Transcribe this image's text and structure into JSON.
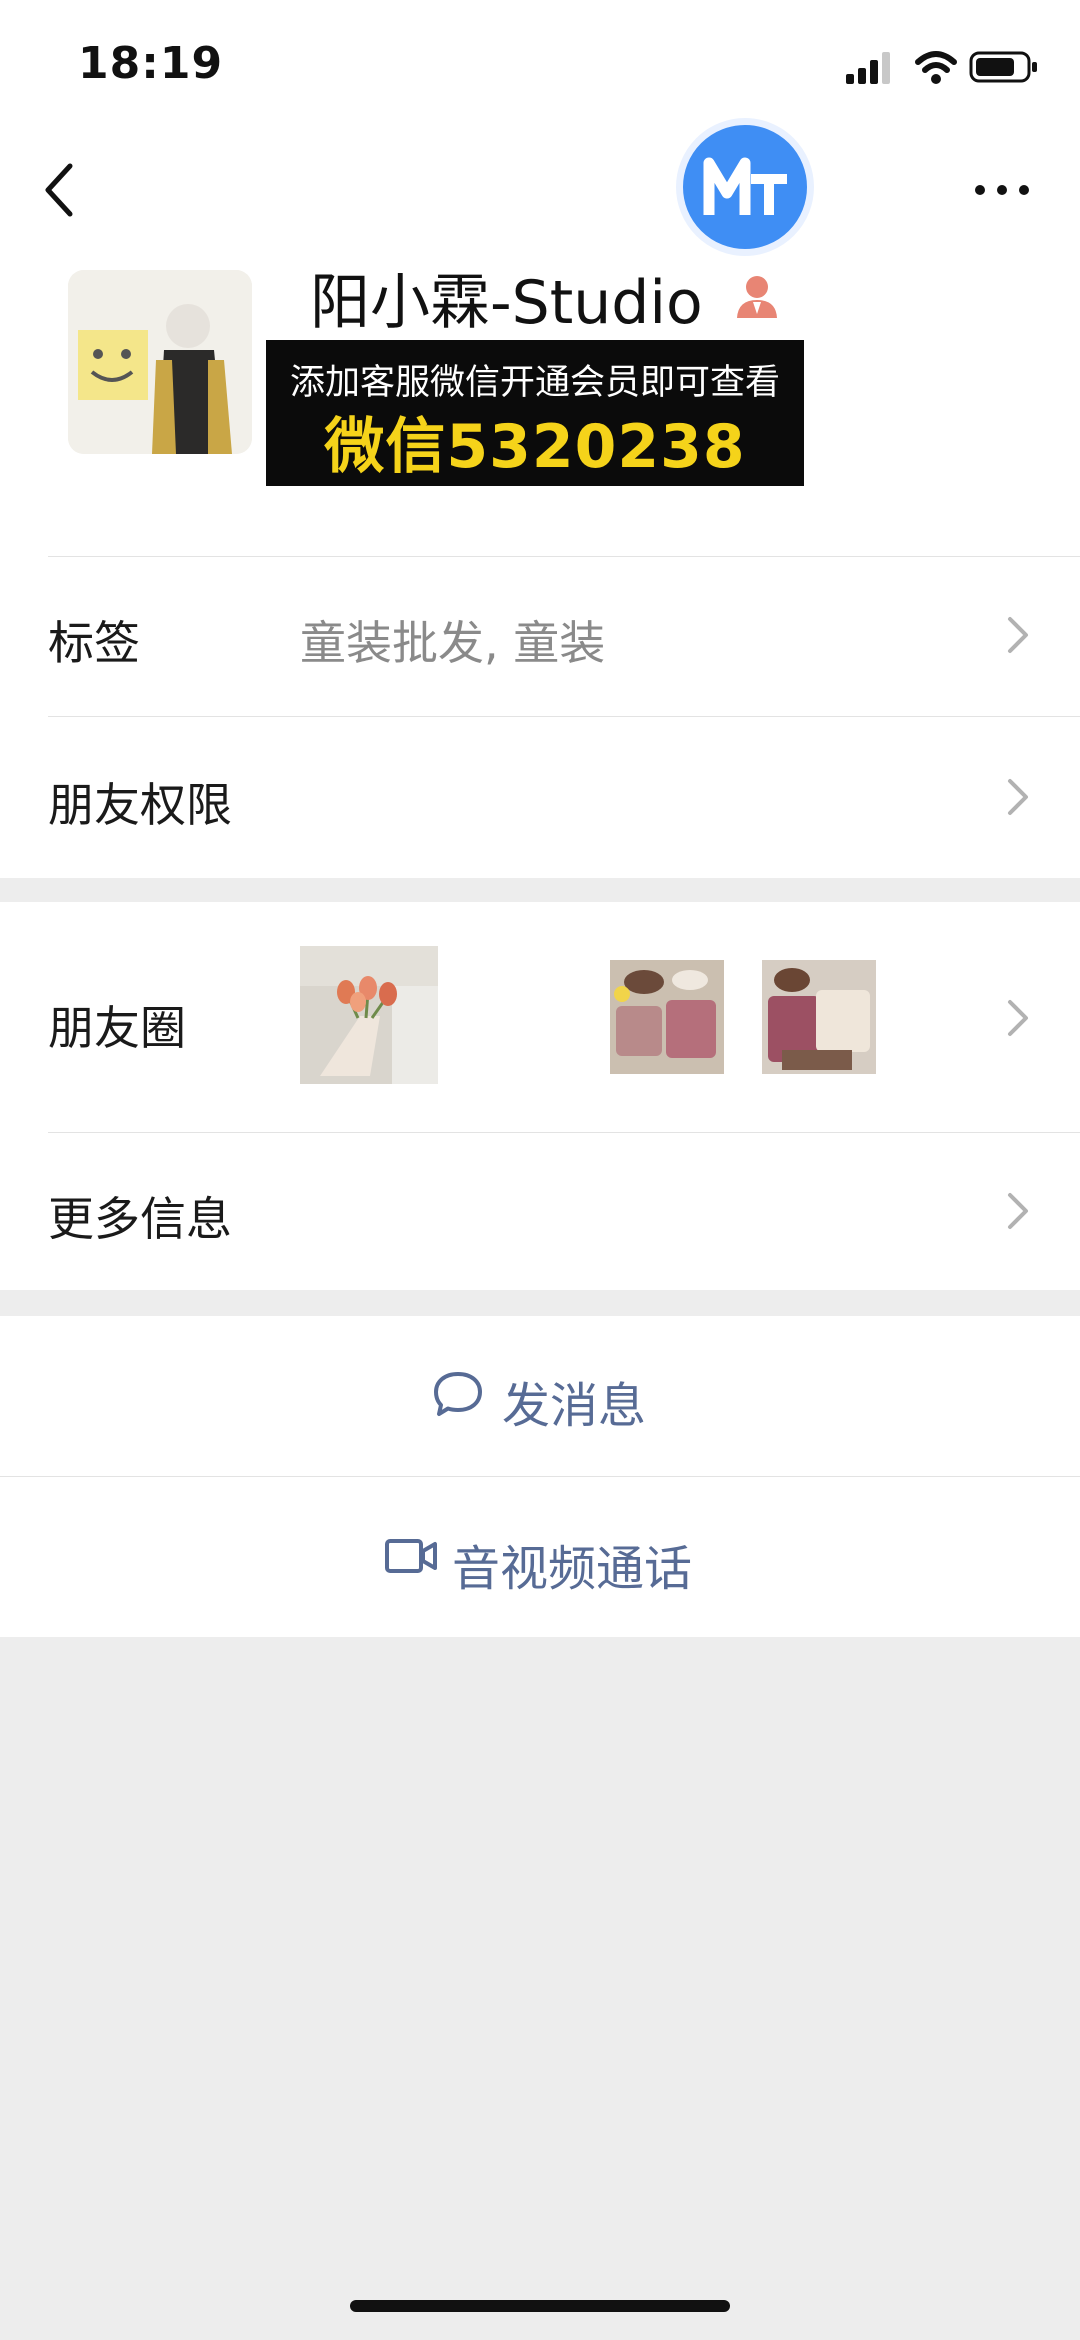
{
  "status_bar": {
    "time": "18:19"
  },
  "profile": {
    "name": "阳小霖-Studio",
    "promo_line1": "添加客服微信开通会员即可查看",
    "promo_line2": "微信5320238"
  },
  "rows": {
    "tags": {
      "label": "标签",
      "value": "童装批发, 童装"
    },
    "friend_permissions": {
      "label": "朋友权限"
    },
    "moments": {
      "label": "朋友圈"
    },
    "more_info": {
      "label": "更多信息"
    }
  },
  "actions": {
    "message": "发消息",
    "video_call": "音视频通话"
  },
  "colors": {
    "link": "#576b95",
    "promo_text": "#f5d31a",
    "badge": "#3f8ef4"
  }
}
